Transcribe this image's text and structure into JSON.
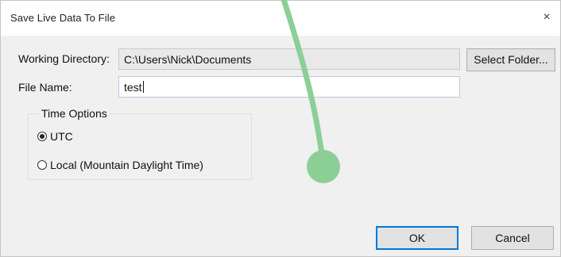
{
  "window": {
    "title": "Save Live Data To File",
    "close_glyph": "×"
  },
  "form": {
    "working_directory_label": "Working Directory:",
    "working_directory_value": "C:\\Users\\Nick\\Documents",
    "select_folder_label": "Select Folder...",
    "file_name_label": "File Name:",
    "file_name_value": "test"
  },
  "time_options": {
    "title": "Time Options",
    "options": [
      {
        "label": "UTC",
        "selected": true
      },
      {
        "label": "Local (Mountain Daylight Time)",
        "selected": false
      }
    ]
  },
  "buttons": {
    "ok_label": "OK",
    "cancel_label": "Cancel"
  },
  "annotation": {
    "color": "#8ccf96"
  },
  "icons": {
    "close": "close-icon",
    "radio_selected": "radio-selected-icon",
    "radio_unselected": "radio-unselected-icon"
  }
}
